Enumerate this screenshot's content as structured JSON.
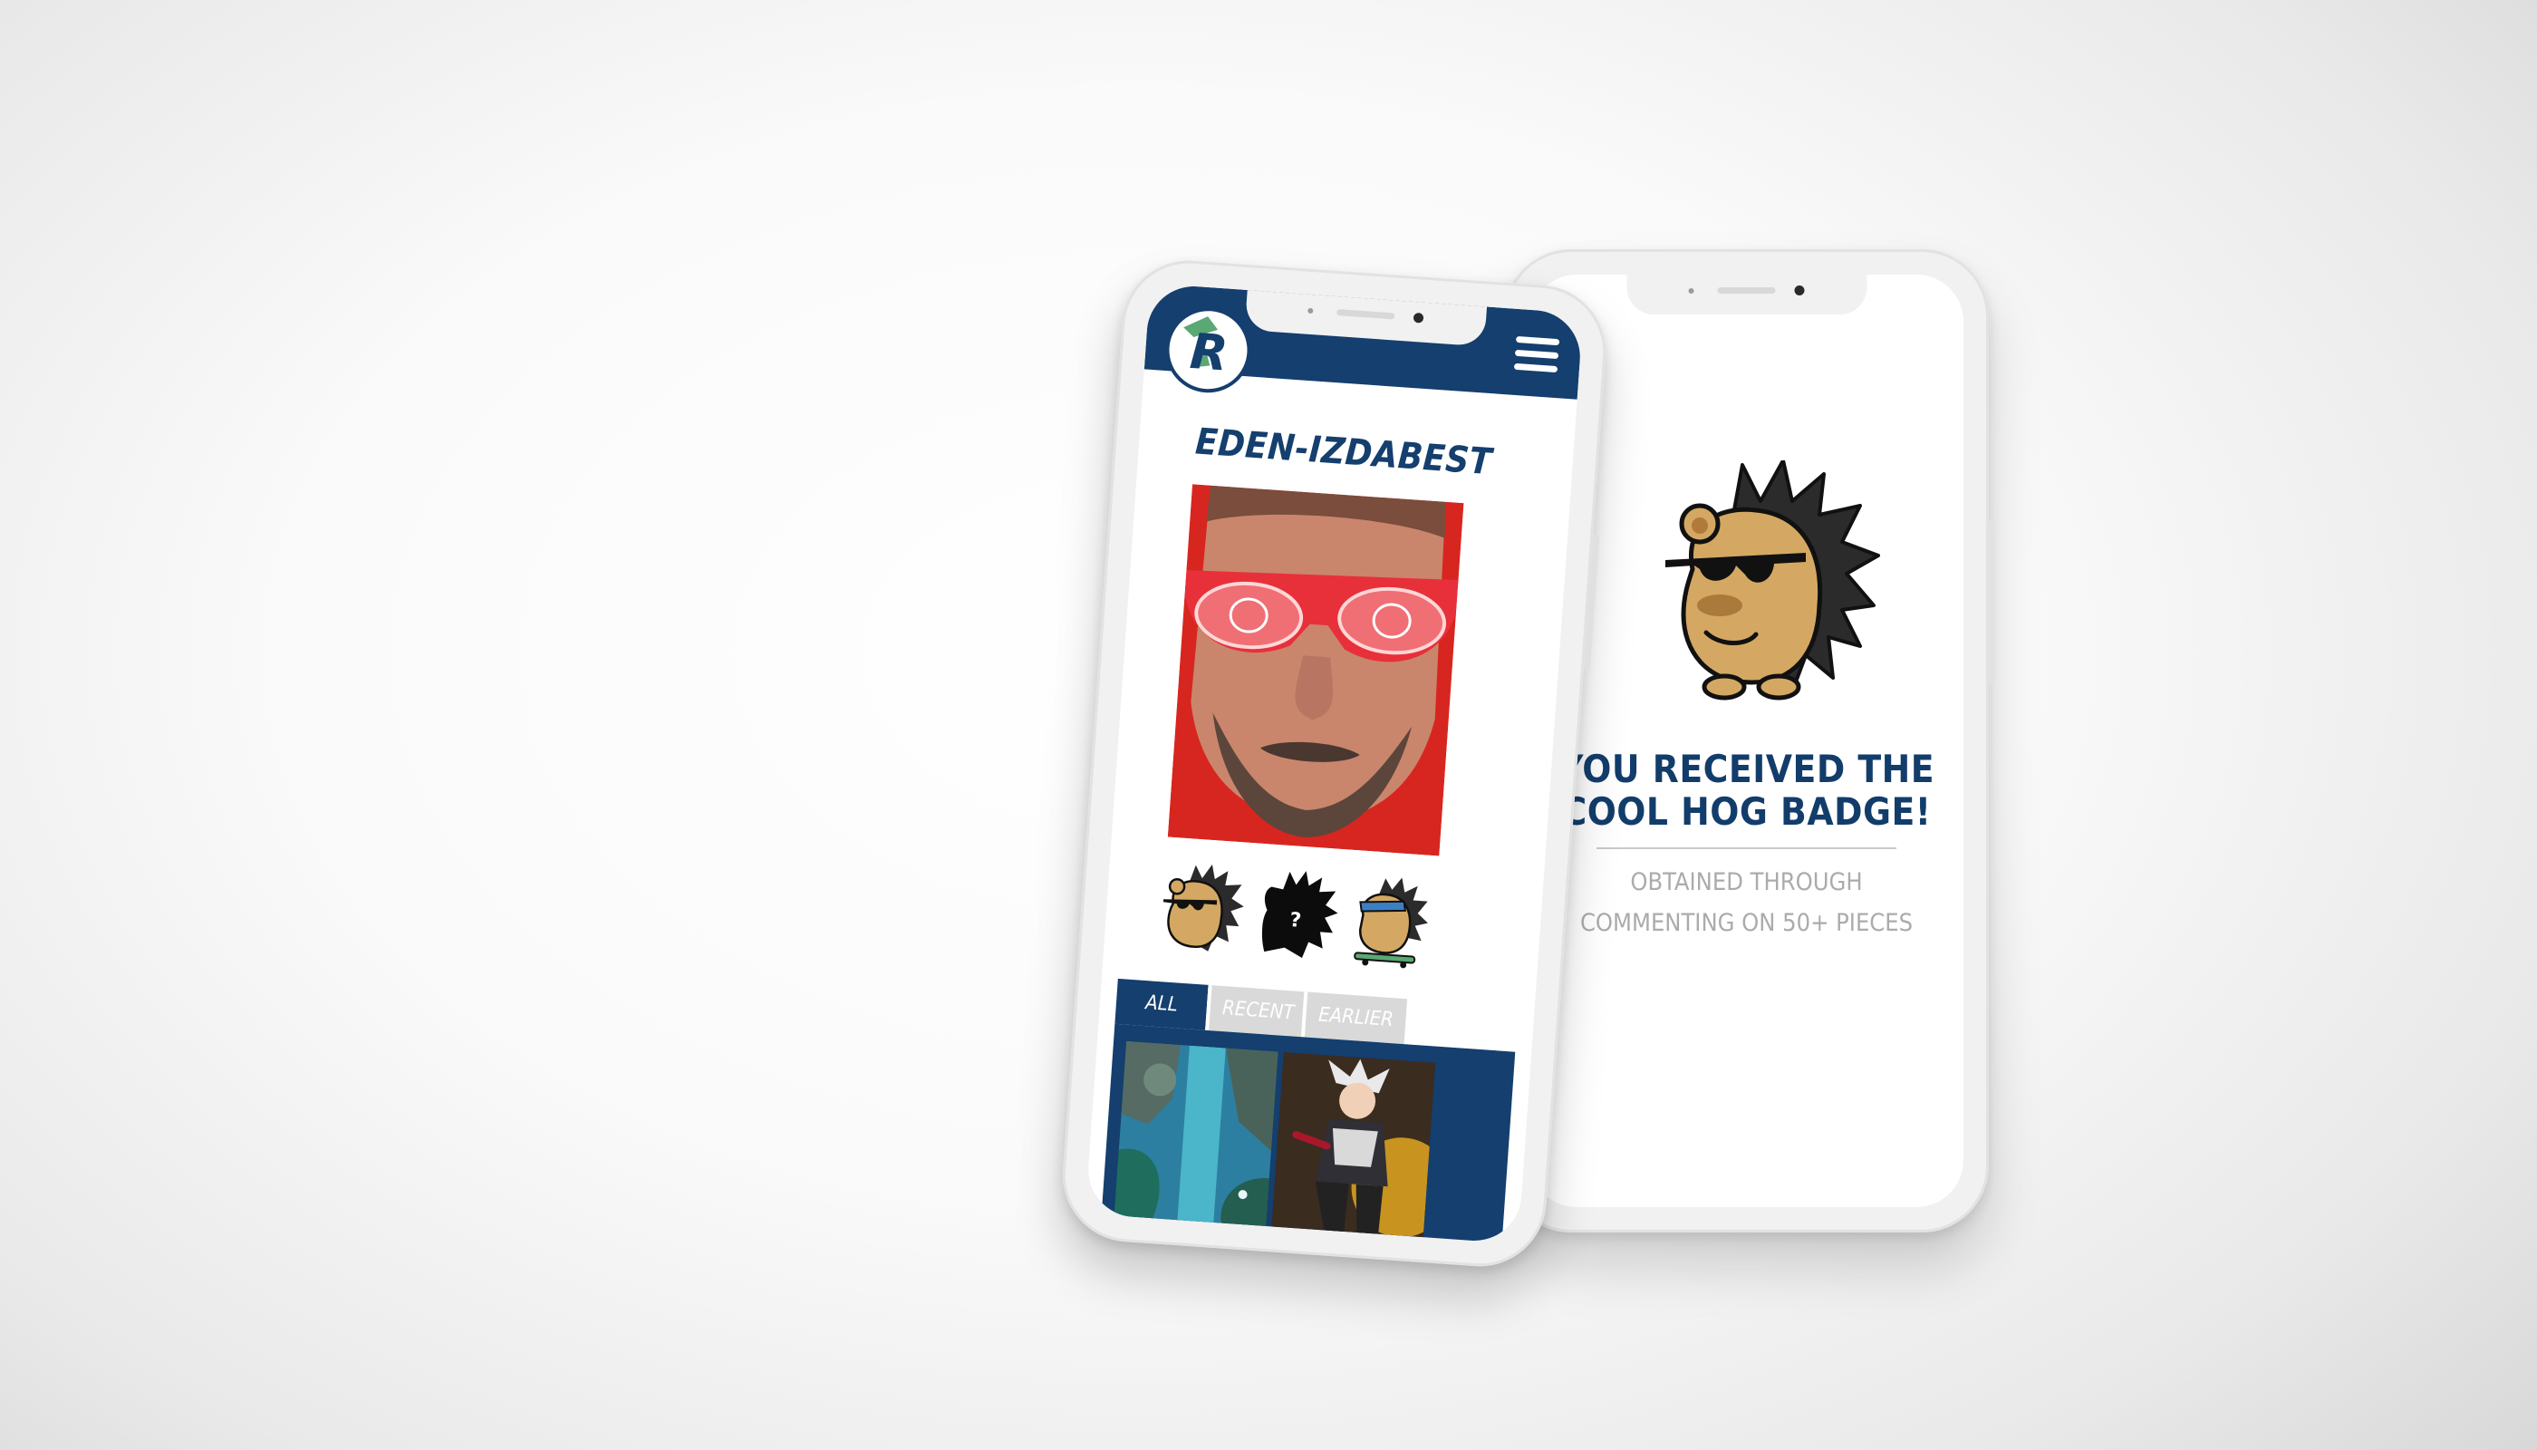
{
  "profile_screen": {
    "username": "EDEN-IZDABEST",
    "logo_letter": "R",
    "tabs": [
      {
        "label": "ALL",
        "active": true
      },
      {
        "label": "RECENT",
        "active": false
      },
      {
        "label": "EARLIER",
        "active": false
      }
    ],
    "badges": [
      {
        "name": "cool-hog",
        "state": "earned"
      },
      {
        "name": "mystery",
        "state": "locked",
        "glyph": "?"
      },
      {
        "name": "skater-hog",
        "state": "earned"
      }
    ],
    "gallery_items": [
      "forest-waterfall-artwork",
      "anime-warrior-artwork"
    ]
  },
  "badge_screen": {
    "title_line1": "YOU RECEIVED THE",
    "title_line2": "COOL HOG BADGE!",
    "subtitle_line1": "OBTAINED THROUGH",
    "subtitle_line2": "COMMENTING ON 50+ PIECES"
  },
  "colors": {
    "brand_navy": "#143f6e",
    "accent_green": "#5aa874",
    "photo_red": "#d6231f",
    "subtitle_gray": "#ababab"
  }
}
